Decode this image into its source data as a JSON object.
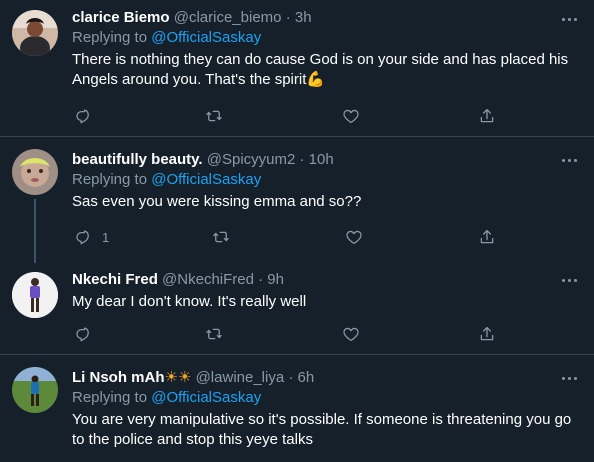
{
  "tweets": [
    {
      "display_name": "clarice Biemo",
      "handle": "@clarice_biemo",
      "time": "· 3h",
      "replying_prefix": "Replying to",
      "replying_to": "@OfficialSaskay",
      "text": "There is nothing they can do cause God is on your side and has placed his Angels around you. That's the spirit💪",
      "reply_count": "",
      "retweet_count": "",
      "like_count": ""
    },
    {
      "display_name": "beautifully beauty.",
      "handle": "@Spicyyum2",
      "time": "· 10h",
      "replying_prefix": "Replying to",
      "replying_to": "@OfficialSaskay",
      "text": "Sas even you were kissing emma and so??",
      "reply_count": "1",
      "retweet_count": "",
      "like_count": ""
    },
    {
      "display_name": "Nkechi Fred",
      "handle": "@NkechiFred",
      "time": "· 9h",
      "text": "My dear I don't  know.  It's  really  well",
      "reply_count": "",
      "retweet_count": "",
      "like_count": ""
    },
    {
      "display_name": "Li Nsoh mAh",
      "name_emoji": "☀☀",
      "handle": "@lawine_liya",
      "time": "· 6h",
      "replying_prefix": "Replying to",
      "replying_to": "@OfficialSaskay",
      "text": "You are very manipulative so it's possible. If someone is threatening you go to the police and stop this yeye talks"
    }
  ],
  "icons": {
    "reply": "reply-icon",
    "retweet": "retweet-icon",
    "like": "heart-icon",
    "share": "share-icon",
    "more": "more-icon"
  },
  "colors": {
    "background": "#15202b",
    "divider": "#38444d",
    "muted": "#8899a6",
    "link": "#1da1f2",
    "text": "#ffffff"
  }
}
